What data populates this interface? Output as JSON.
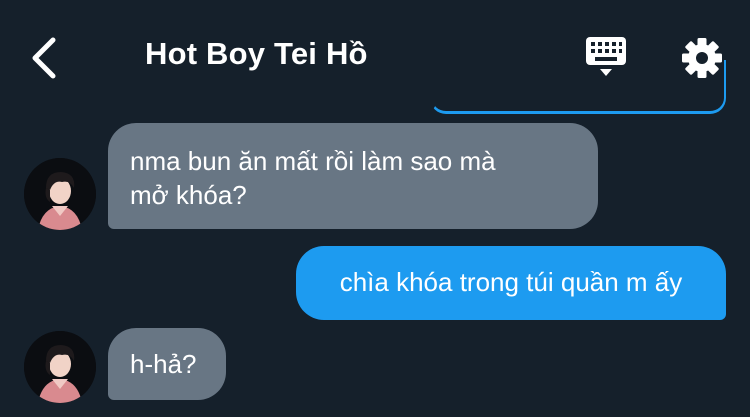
{
  "header": {
    "title": "Hot Boy Tei Hồ",
    "back_icon": "chevron-left-icon",
    "keyboard_icon": "keyboard-icon",
    "settings_icon": "gear-icon"
  },
  "messages": [
    {
      "direction": "incoming",
      "text_line1": "nma bun ăn mất rồi làm sao mà",
      "text_line2": "mở khóa?"
    },
    {
      "direction": "outgoing",
      "text": "chìa khóa trong túi quần m ấy"
    },
    {
      "direction": "incoming",
      "text": "h-hả?"
    }
  ],
  "colors": {
    "background": "#15202b",
    "incoming_bubble": "#687684",
    "outgoing_bubble": "#1d9bf0",
    "text": "#ffffff"
  }
}
